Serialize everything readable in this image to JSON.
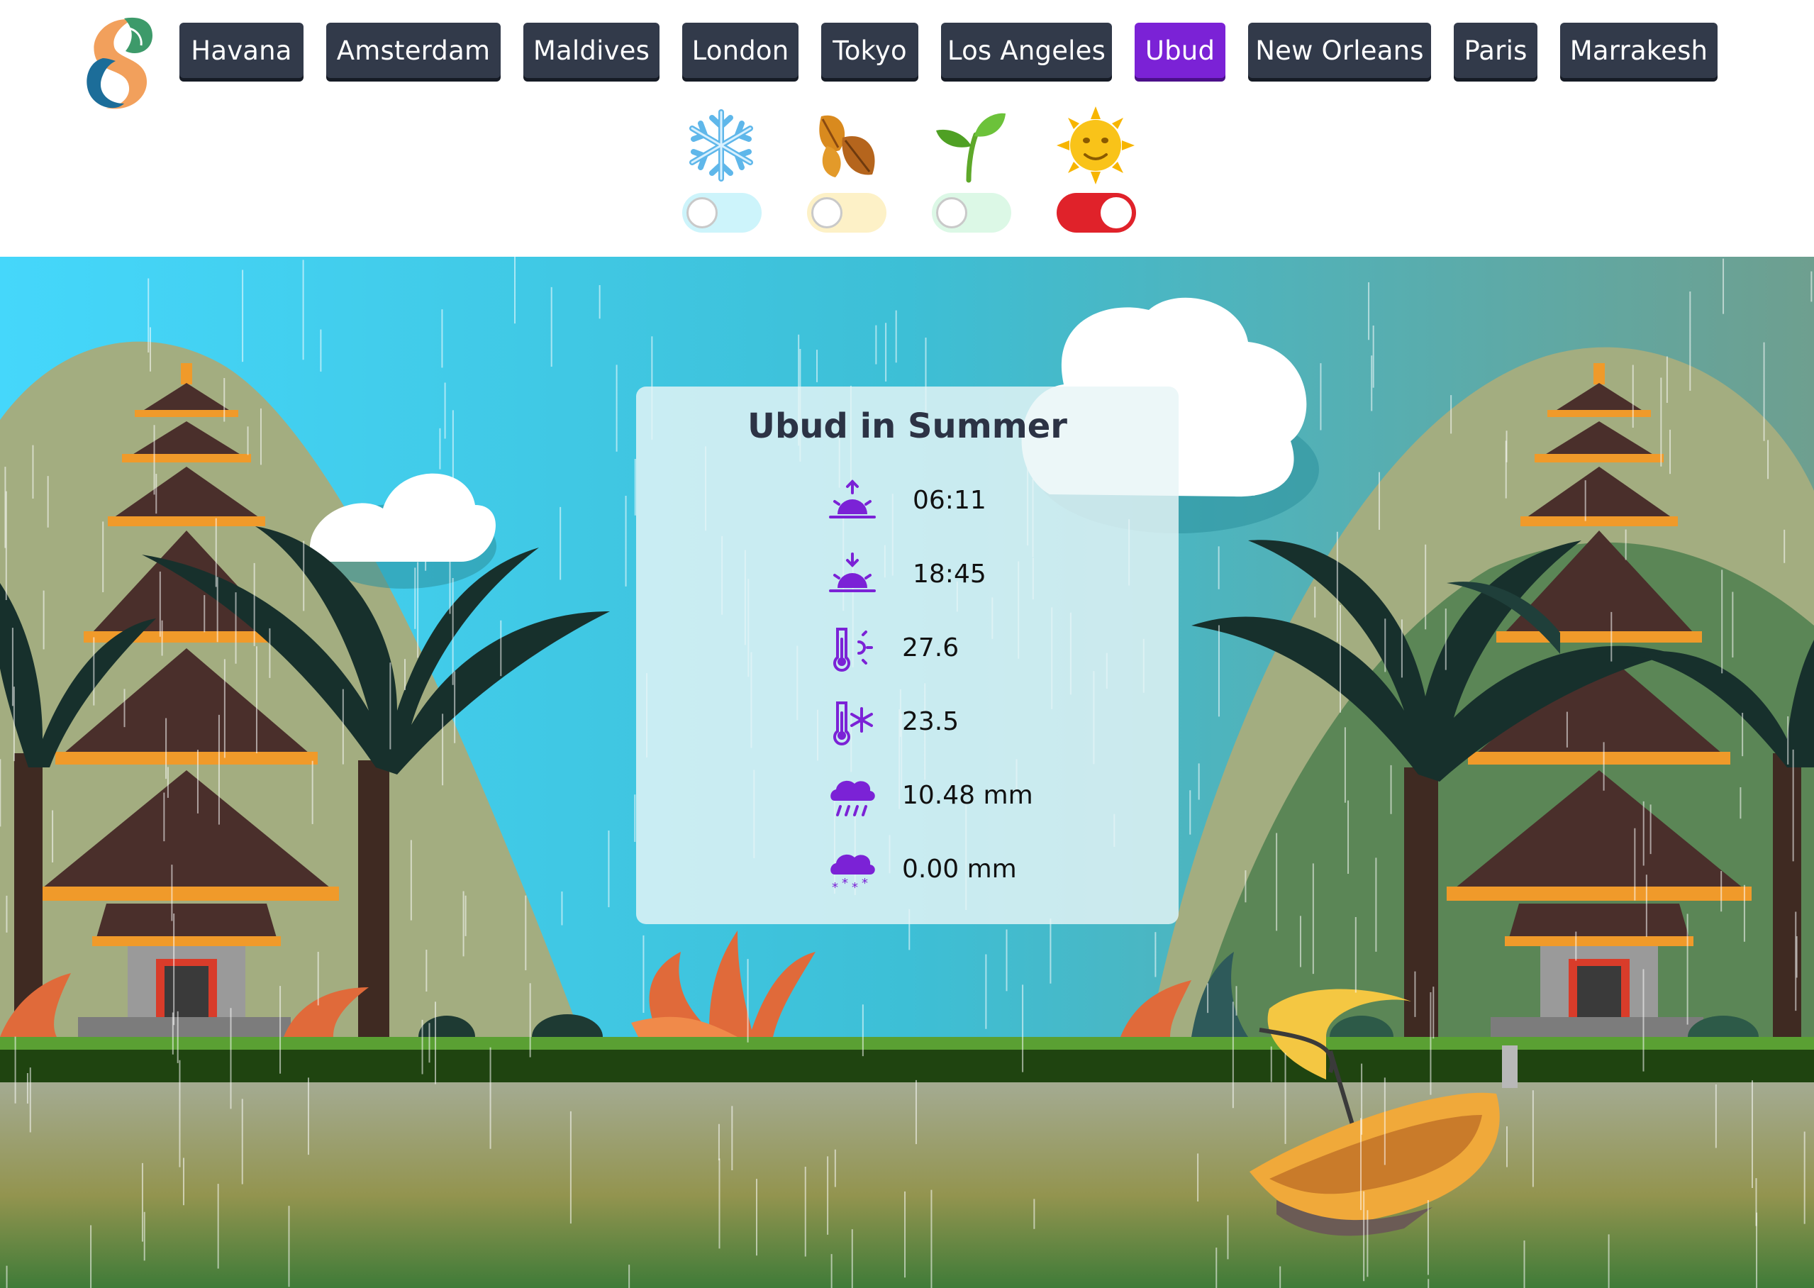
{
  "nav": {
    "cities": [
      {
        "label": "Havana",
        "active": false
      },
      {
        "label": "Amsterdam",
        "active": false
      },
      {
        "label": "Maldives",
        "active": false
      },
      {
        "label": "London",
        "active": false
      },
      {
        "label": "Tokyo",
        "active": false
      },
      {
        "label": "Los Angeles",
        "active": false
      },
      {
        "label": "Ubud",
        "active": true
      },
      {
        "label": "New Orleans",
        "active": false
      },
      {
        "label": "Paris",
        "active": false
      },
      {
        "label": "Marrakesh",
        "active": false
      }
    ]
  },
  "seasons": [
    {
      "icon": "snowflake-icon",
      "glyph": "❄️",
      "enabled": false,
      "track_color": "#cdf4fb"
    },
    {
      "icon": "fallen-leaves-icon",
      "glyph": "🍂",
      "enabled": false,
      "track_color": "#fdf1c7"
    },
    {
      "icon": "seedling-icon",
      "glyph": "🌱",
      "enabled": false,
      "track_color": "#dcf8e6"
    },
    {
      "icon": "sun-face-icon",
      "glyph": "🌞",
      "enabled": true,
      "track_color": "#e0222a"
    }
  ],
  "card": {
    "title": "Ubud in Summer",
    "sunrise": "06:11",
    "sunset": "18:45",
    "temp_max": "27.6",
    "temp_min": "23.5",
    "rain": "10.48 mm",
    "snow": "0.00 mm"
  },
  "colors": {
    "accent": "#7b22d6",
    "button": "#323a4a",
    "toggle_on": "#e0222a",
    "card_title": "#2c3345"
  }
}
